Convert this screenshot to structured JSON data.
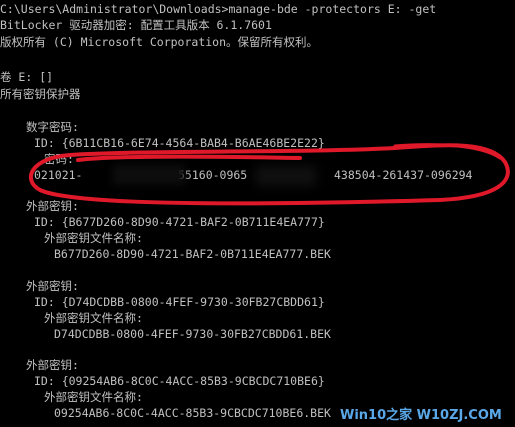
{
  "colors": {
    "background": "#000000",
    "text": "#c0c0c0",
    "annotation": "#e0192a",
    "watermark": "#5aa8e8"
  },
  "console": {
    "command_line": "C:\\Users\\Administrator\\Downloads>manage-bde -protectors E: -get",
    "header_line1": "BitLocker 驱动器加密: 配置工具版本 6.1.7601",
    "header_line2": "版权所有 (C) Microsoft Corporation。保留所有权利。",
    "volume_line": "卷 E: []",
    "all_protectors": "所有密钥保护器",
    "numeric_password_label": "数字密码:",
    "numeric_password_id": "ID: {6B11CB16-6E74-4564-BAB4-B6AE46BE2E22}",
    "password_label": "密码:",
    "password_part1": "021021-",
    "password_part2": "55160-0965",
    "password_part3": "438504-261437-096294",
    "external_keys": [
      {
        "label": "外部密钥:",
        "id": "ID: {B677D260-8D90-4721-BAF2-0B711E4EA777}",
        "file_label": "外部密钥文件名称:",
        "file_name": "B677D260-8D90-4721-BAF2-0B711E4EA777.BEK"
      },
      {
        "label": "外部密钥:",
        "id": "ID: {D74DCDBB-0800-4FEF-9730-30FB27CBDD61}",
        "file_label": "外部密钥文件名称:",
        "file_name": "D74DCDBB-0800-4FEF-9730-30FB27CBDD61.BEK"
      },
      {
        "label": "外部密钥:",
        "id": "ID: {09254AB6-8C0C-4ACC-85B3-9CBCDC710BE6}",
        "file_label": "外部密钥文件名称:",
        "file_name": "09254AB6-8C0C-4ACC-85B3-9CBCDC710BE6.BEK"
      }
    ]
  },
  "watermark": "Win10之家 W10ZJ.COM"
}
